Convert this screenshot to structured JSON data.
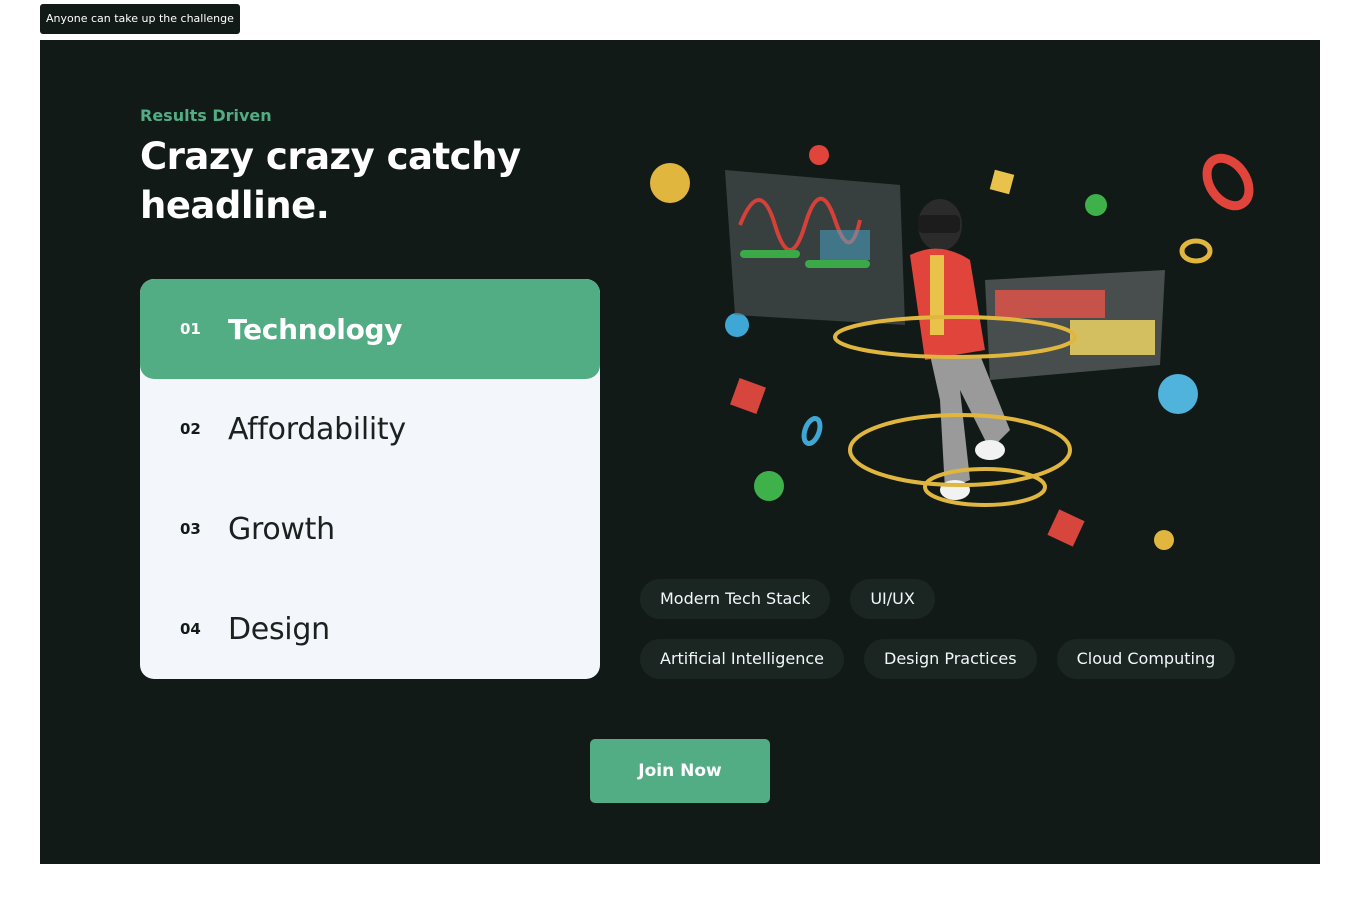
{
  "banner": {
    "text": "Anyone can take up the challenge"
  },
  "hero": {
    "eyebrow": "Results Driven",
    "headline": "Crazy crazy catchy headline."
  },
  "tabs": [
    {
      "num": "01",
      "label": "Technology",
      "active": true
    },
    {
      "num": "02",
      "label": "Affordability",
      "active": false
    },
    {
      "num": "03",
      "label": "Growth",
      "active": false
    },
    {
      "num": "04",
      "label": "Design",
      "active": false
    }
  ],
  "pills": {
    "row1": [
      "Modern Tech Stack",
      "UI/UX"
    ],
    "row2": [
      "Artificial Intelligence",
      "Design Practices",
      "Cloud Computing"
    ]
  },
  "cta": {
    "label": "Join Now"
  },
  "colors": {
    "background": "#121a18",
    "accent": "#52ac84",
    "panel": "#f3f7fb",
    "pill": "#1b2622"
  },
  "illustration": {
    "icon": "vr-person-illustration"
  }
}
